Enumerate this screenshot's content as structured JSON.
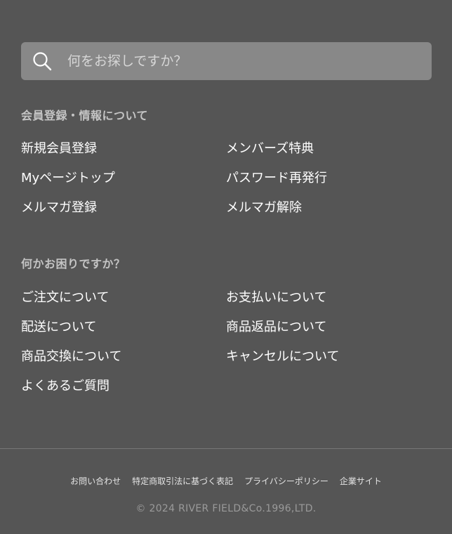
{
  "search": {
    "placeholder": "何をお探しですか？",
    "icon": "search-icon"
  },
  "member_section": {
    "title": "会員登録・情報について",
    "links": [
      "新規会員登録",
      "メンバーズ特典",
      "Myページトップ",
      "パスワード再発行",
      "メルマガ登録",
      "メルマガ解除"
    ]
  },
  "help_section": {
    "title": "何かお困りですか？",
    "links": [
      "ご注文について",
      "お支払いについて",
      "配送について",
      "商品返品について",
      "商品交換について",
      "キャンセルについて",
      "よくあるご質問"
    ]
  },
  "footer": {
    "links": [
      "お問い合わせ",
      "特定商取引法に基づく表記",
      "プライバシーポリシー",
      "企業サイト"
    ],
    "copyright": "© 2024 RIVER FIELD&Co.1996,LTD."
  },
  "colors": {
    "background": "#555555",
    "search_bg": "#888888",
    "section_title": "#c4c4c4",
    "copyright": "#9a9a9a"
  }
}
